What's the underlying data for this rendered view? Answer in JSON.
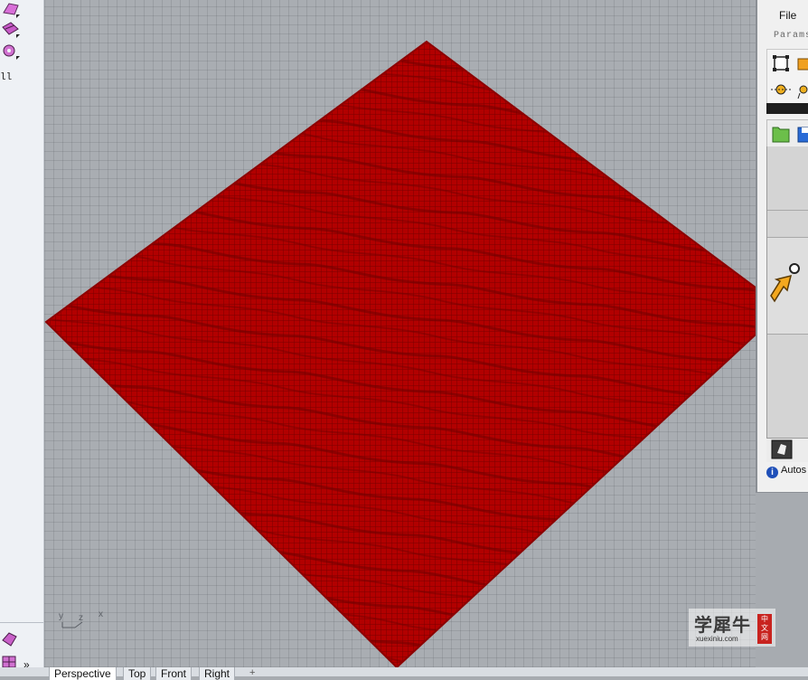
{
  "left_toolbar": {
    "truncated_label": "ll",
    "more_chevron": "»",
    "icons": [
      "surface-tool-icon",
      "patch-tool-icon",
      "gear-mesh-icon",
      "solid-tool-icon",
      "grid-tool-icon"
    ]
  },
  "viewport": {
    "name": "Perspective",
    "mesh_color": "#aa0000",
    "background_color": "#a9adb2",
    "axis_labels": {
      "y": "y",
      "z": "z",
      "x": "x"
    }
  },
  "viewport_tabs": [
    {
      "label": "Perspective",
      "active": true
    },
    {
      "label": "Top",
      "active": false
    },
    {
      "label": "Front",
      "active": false
    },
    {
      "label": "Right",
      "active": false
    }
  ],
  "tab_add_symbol": "+",
  "grasshopper": {
    "menu_file": "File",
    "tab_params": "Params",
    "autosave_text": "Autos",
    "info_glyph": "i"
  },
  "watermark": {
    "title": "学犀牛",
    "url": "xuexiniu.com",
    "badge_line1": "中",
    "badge_line2": "文",
    "badge_line3": "网"
  }
}
